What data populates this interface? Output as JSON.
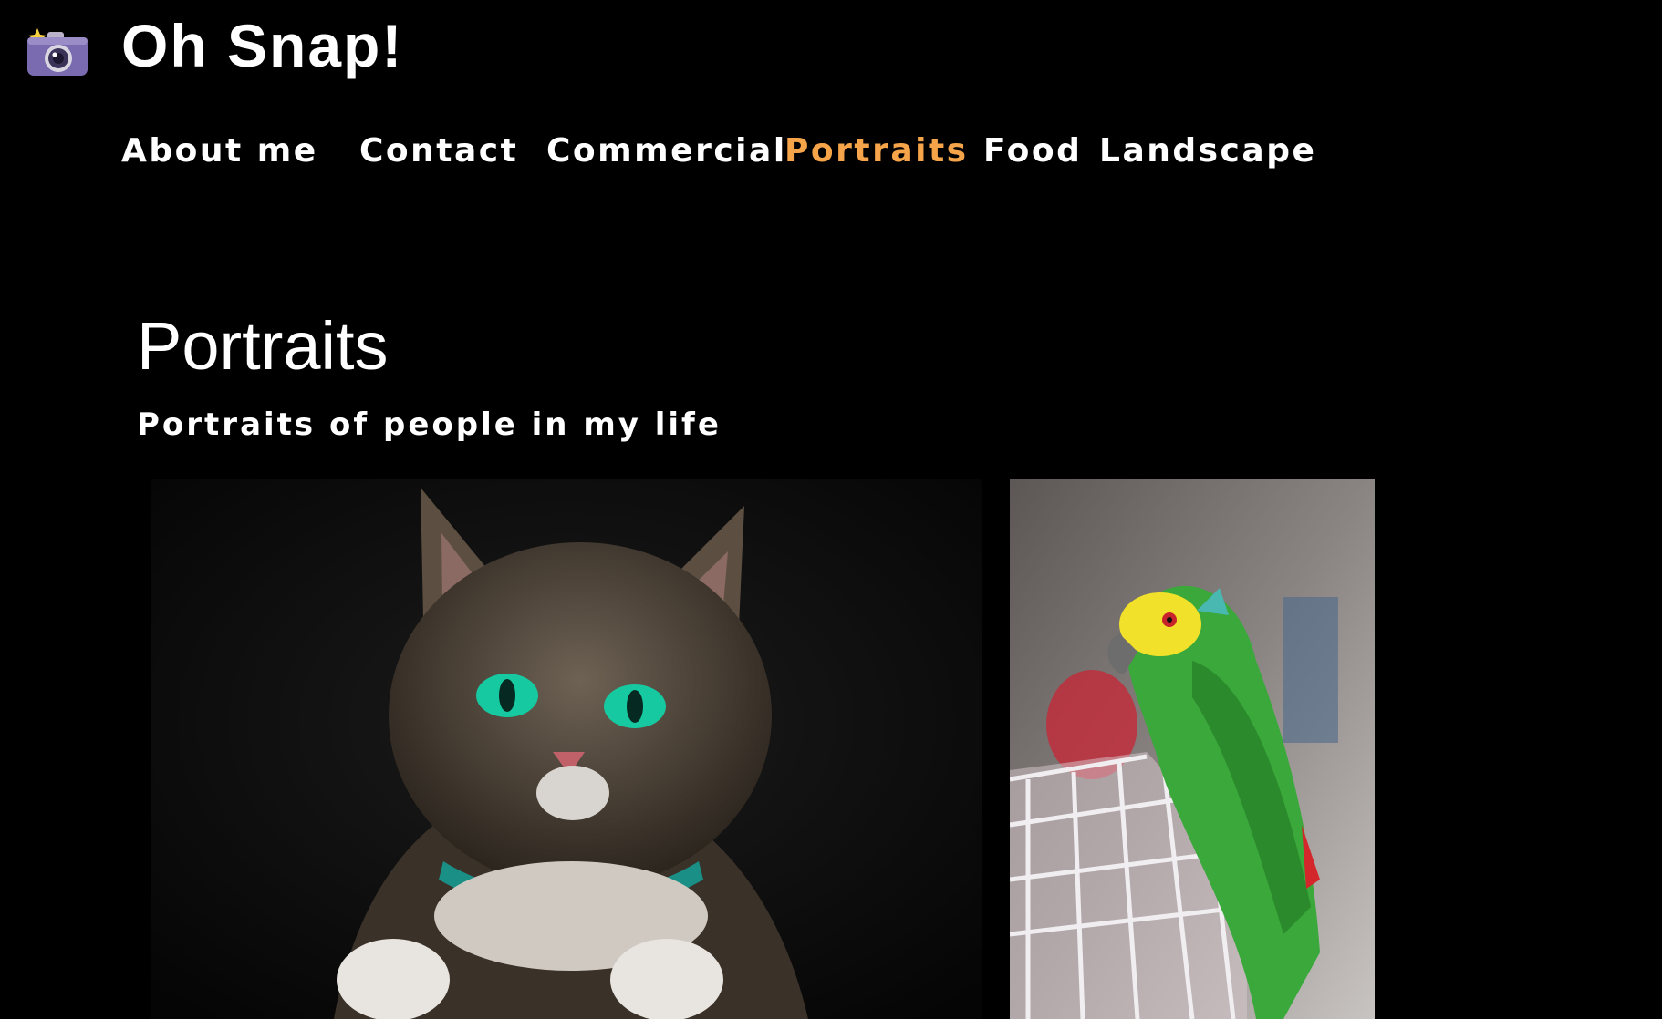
{
  "header": {
    "logo_icon": "camera-with-flash-icon",
    "title": "Oh Snap!"
  },
  "nav": {
    "items": [
      {
        "label": "About me",
        "active": false
      },
      {
        "label": "Contact",
        "active": false
      },
      {
        "label": "Commercial",
        "active": false
      },
      {
        "label": "Portraits",
        "active": true
      },
      {
        "label": "Food",
        "active": false
      },
      {
        "label": "Landscape",
        "active": false
      }
    ],
    "active_color": "#f5a44a",
    "default_color": "#ffffff"
  },
  "main": {
    "title": "Portraits",
    "subtitle": "Portraits of people in my life",
    "photos": [
      {
        "subject": "tabby cat with green eyes"
      },
      {
        "subject": "green parrot on white cage"
      }
    ]
  },
  "colors": {
    "background": "#000000",
    "text": "#ffffff",
    "accent": "#f5a44a"
  }
}
